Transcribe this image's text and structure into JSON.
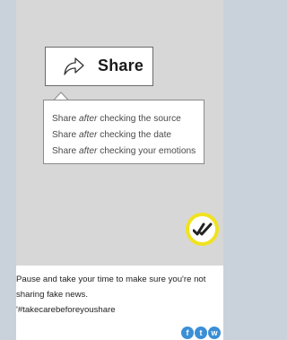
{
  "post": {
    "media": {
      "share_label": "Share",
      "tooltip_lines": [
        {
          "before": "Share ",
          "emph": "after",
          "after": " checking the source"
        },
        {
          "before": "Share ",
          "emph": "after",
          "after": " checking the date"
        },
        {
          "before": "Share ",
          "emph": "after",
          "after": " checking your emotions"
        }
      ]
    },
    "caption_line1": "Pause and take your time to make sure you're not",
    "caption_line2": "sharing fake news.",
    "caption_line3": "'#takecarebeforeyoushare"
  },
  "social": [
    {
      "icon": "facebook-icon",
      "glyph": "f"
    },
    {
      "icon": "twitter-icon",
      "glyph": "t"
    },
    {
      "icon": "whatsapp-icon",
      "glyph": "w"
    }
  ],
  "colors": {
    "page_bg": "#c9d2db",
    "badge_ring": "#f0e21f",
    "social_blue": "#3a8fd6"
  }
}
